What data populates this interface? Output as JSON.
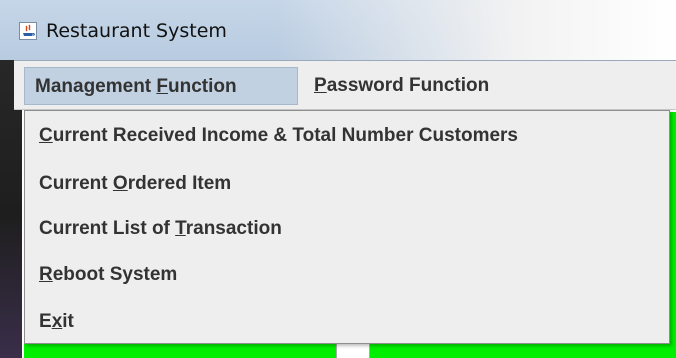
{
  "window": {
    "title": "Restaurant System",
    "icon": "java-app-icon"
  },
  "menubar": {
    "items": [
      {
        "label_pre": "Management ",
        "label_mnemonic": "F",
        "label_post": "unction",
        "active": true
      },
      {
        "label_pre": "",
        "label_mnemonic": "P",
        "label_post": "assword Function",
        "active": false
      }
    ]
  },
  "dropdown": {
    "items": [
      {
        "pre": "",
        "mn": "C",
        "post": "urrent Received Income & Total Number Customers"
      },
      {
        "pre": "Current ",
        "mn": "O",
        "post": "rdered Item"
      },
      {
        "pre": "Current List of ",
        "mn": "T",
        "post": "ransaction"
      },
      {
        "pre": "",
        "mn": "R",
        "post": "eboot System"
      },
      {
        "pre": "E",
        "mn": "x",
        "post": "it"
      }
    ]
  },
  "colors": {
    "green_background": "#00ee00",
    "menu_background": "#eeeeee",
    "active_menu_highlight": "#c2d1e2"
  }
}
